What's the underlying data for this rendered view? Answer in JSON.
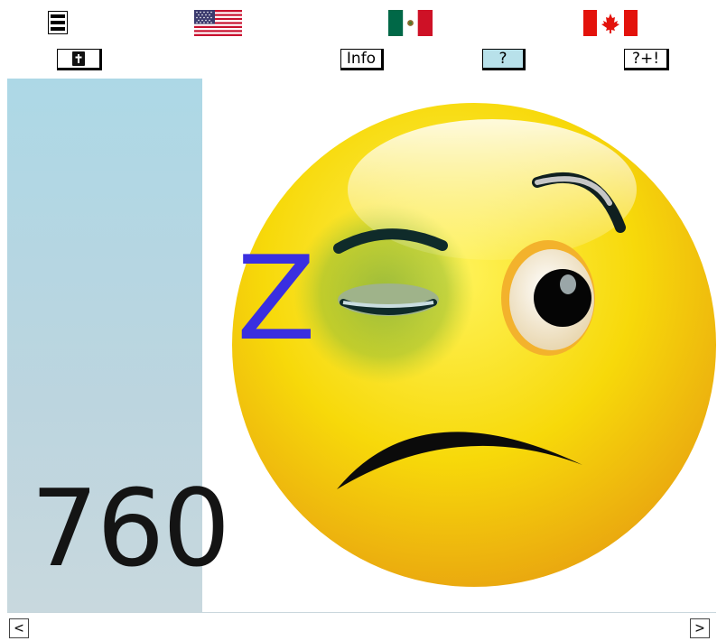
{
  "topbar": {
    "menu_icon": "hamburger-menu-icon",
    "flags": [
      {
        "name": "us-flag-icon",
        "language": "English"
      },
      {
        "name": "mexico-flag-icon",
        "language": "Spanish"
      },
      {
        "name": "canada-flag-icon",
        "language": "French"
      }
    ]
  },
  "toolbar": {
    "book_icon": "bible-book-icon",
    "info_label": "Info",
    "help_label": "?",
    "more_label": "?+!"
  },
  "colors": {
    "panel": "#add8e6",
    "help_active": "#b8e1ea",
    "z_letter": "#3a2fe0",
    "emoji_yellow": "#f7d90a"
  },
  "panel": {
    "counter": "760"
  },
  "illustration": {
    "name": "sleepy-black-eye-emoji",
    "z_letter": "Z"
  },
  "nav": {
    "prev_label": "<",
    "next_label": ">"
  }
}
